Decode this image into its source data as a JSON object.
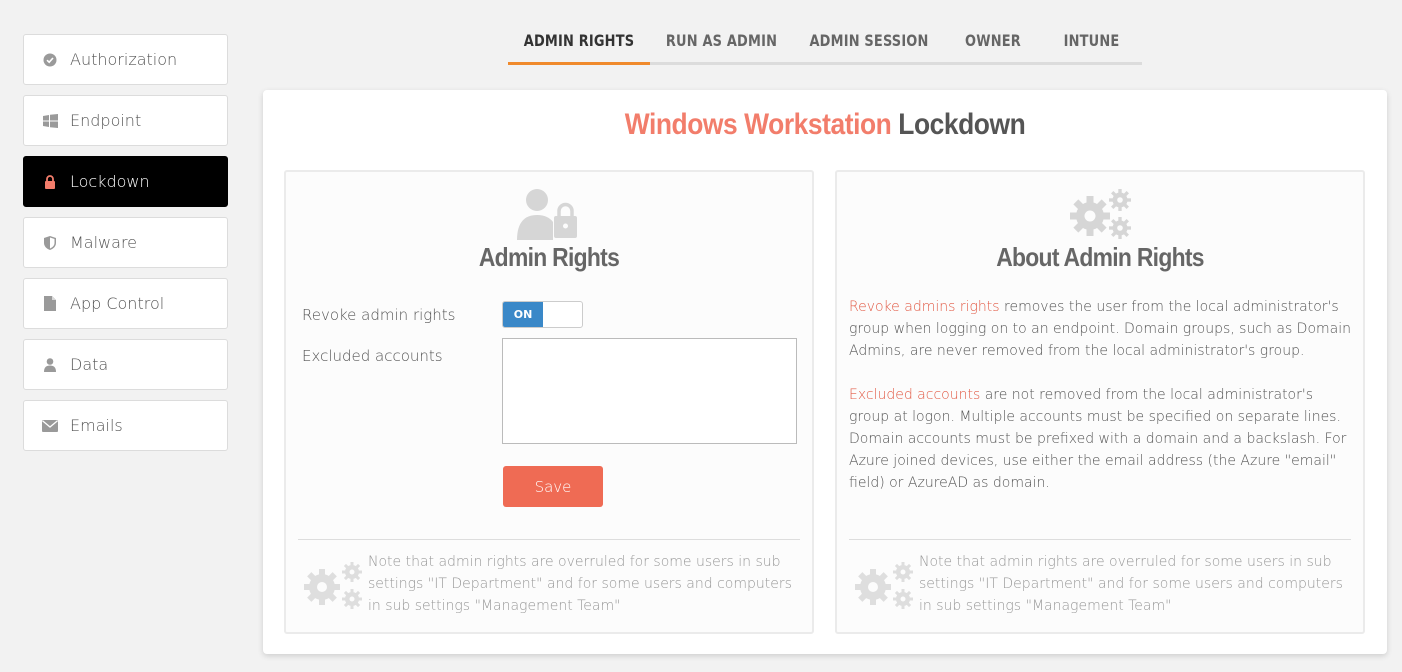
{
  "sidebar": {
    "items": [
      {
        "label": "Authorization",
        "icon": "check-circle-icon"
      },
      {
        "label": "Endpoint",
        "icon": "windows-icon"
      },
      {
        "label": "Lockdown",
        "icon": "lock-icon",
        "active": true
      },
      {
        "label": "Malware",
        "icon": "shield-icon"
      },
      {
        "label": "App Control",
        "icon": "file-icon"
      },
      {
        "label": "Data",
        "icon": "user-icon"
      },
      {
        "label": "Emails",
        "icon": "envelope-icon"
      }
    ]
  },
  "tabs": [
    {
      "label": "ADMIN RIGHTS",
      "active": true
    },
    {
      "label": "RUN AS ADMIN"
    },
    {
      "label": "ADMIN SESSION"
    },
    {
      "label": "OWNER"
    },
    {
      "label": "INTUNE"
    }
  ],
  "header": {
    "title_accent": "Windows Workstation",
    "title_rest": "Lockdown"
  },
  "left_panel": {
    "title": "Admin Rights",
    "revoke_label": "Revoke admin rights",
    "toggle_state": "ON",
    "excluded_label": "Excluded accounts",
    "excluded_value": "",
    "save_label": "Save",
    "note": "Note that admin rights are overruled for some users in sub settings \"IT Department\" and for some users and computers in sub settings \"Management Team\""
  },
  "right_panel": {
    "title": "About Admin Rights",
    "p1_highlight": "Revoke admins rights",
    "p1_text": " removes the user from the local administrator's group when logging on to an endpoint. Domain groups, such as Domain Admins, are never removed from the local administrator's group.",
    "p2_highlight": "Excluded accounts",
    "p2_text": " are not removed from the local administrator's group at logon. Multiple accounts must be specified on separate lines. Domain accounts must be prefixed with a domain and a backslash. For Azure joined devices, use either the email address (the Azure \"email\" field) or AzureAD as domain.",
    "note": "Note that admin rights are overruled for some users in sub settings \"IT Department\" and for some users and computers in sub settings \"Management Team\""
  },
  "colors": {
    "accent": "#f27d6b",
    "tab_underline": "#f08a2c",
    "toggle_on": "#3a88c8",
    "save_button": "#ef6b54"
  }
}
